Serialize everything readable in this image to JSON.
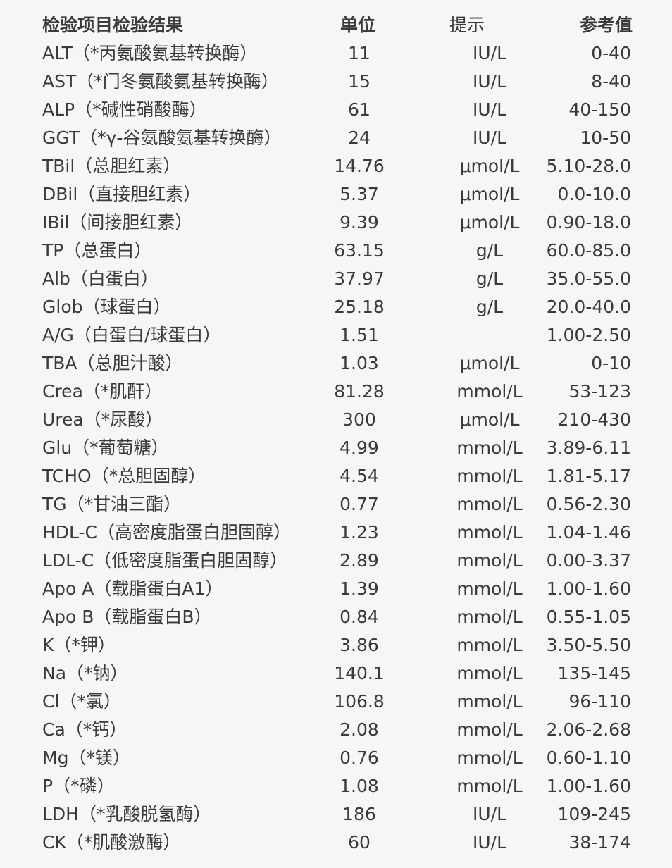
{
  "header": {
    "item_result": "检验项目检验结果",
    "unit": "单位",
    "hint": "提示",
    "reference": "参考值"
  },
  "rows": [
    {
      "name": "ALT（*丙氨酸氨基转换酶）",
      "value": "11",
      "unit": "IU/L",
      "reference": "0-40"
    },
    {
      "name": "AST（*门冬氨酸氨基转换酶）",
      "value": "15",
      "unit": "IU/L",
      "reference": "8-40"
    },
    {
      "name": "ALP（*碱性硝酸酶）",
      "value": "61",
      "unit": "IU/L",
      "reference": "40-150"
    },
    {
      "name": "GGT（*γ-谷氨酸氨基转换酶）",
      "value": "24",
      "unit": "IU/L",
      "reference": "10-50"
    },
    {
      "name": "TBil（总胆红素）",
      "value": "14.76",
      "unit": "μmol/L",
      "reference": "5.10-28.0"
    },
    {
      "name": "DBil（直接胆红素）",
      "value": "5.37",
      "unit": "μmol/L",
      "reference": "0.0-10.0"
    },
    {
      "name": "IBil（间接胆红素）",
      "value": "9.39",
      "unit": "μmol/L",
      "reference": "0.90-18.0"
    },
    {
      "name": "TP（总蛋白）",
      "value": "63.15",
      "unit": "g/L",
      "reference": "60.0-85.0"
    },
    {
      "name": "Alb（白蛋白）",
      "value": "37.97",
      "unit": "g/L",
      "reference": "35.0-55.0"
    },
    {
      "name": "Glob（球蛋白）",
      "value": "25.18",
      "unit": "g/L",
      "reference": "20.0-40.0"
    },
    {
      "name": "A/G（白蛋白/球蛋白）",
      "value": "1.51",
      "unit": "",
      "reference": "1.00-2.50"
    },
    {
      "name": "TBA（总胆汁酸）",
      "value": "1.03",
      "unit": "μmol/L",
      "reference": "0-10"
    },
    {
      "name": "Crea（*肌酐）",
      "value": "81.28",
      "unit": "mmol/L",
      "reference": "53-123"
    },
    {
      "name": "Urea（*尿酸）",
      "value": "300",
      "unit": "μmol/L",
      "reference": "210-430"
    },
    {
      "name": "Glu（*葡萄糖）",
      "value": "4.99",
      "unit": "mmol/L",
      "reference": "3.89-6.11"
    },
    {
      "name": "TCHO（*总胆固醇）",
      "value": "4.54",
      "unit": "mmol/L",
      "reference": "1.81-5.17"
    },
    {
      "name": "TG（*甘油三酯）",
      "value": "0.77",
      "unit": "mmol/L",
      "reference": "0.56-2.30"
    },
    {
      "name": "HDL-C（高密度脂蛋白胆固醇）",
      "value": "1.23",
      "unit": "mmol/L",
      "reference": "1.04-1.46"
    },
    {
      "name": "LDL-C（低密度脂蛋白胆固醇）",
      "value": "2.89",
      "unit": "mmol/L",
      "reference": "0.00-3.37"
    },
    {
      "name": "Apo A（载脂蛋白A1）",
      "value": "1.39",
      "unit": "mmol/L",
      "reference": "1.00-1.60"
    },
    {
      "name": "Apo B（载脂蛋白B）",
      "value": "0.84",
      "unit": "mmol/L",
      "reference": "0.55-1.05"
    },
    {
      "name": "K（*钾）",
      "value": "3.86",
      "unit": "mmol/L",
      "reference": "3.50-5.50"
    },
    {
      "name": "Na（*钠）",
      "value": "140.1",
      "unit": "mmol/L",
      "reference": "135-145"
    },
    {
      "name": "Cl（*氯）",
      "value": "106.8",
      "unit": "mmol/L",
      "reference": "96-110"
    },
    {
      "name": "Ca（*钙）",
      "value": "2.08",
      "unit": "mmol/L",
      "reference": "2.06-2.68"
    },
    {
      "name": "Mg（*镁）",
      "value": "0.76",
      "unit": "mmol/L",
      "reference": "0.60-1.10"
    },
    {
      "name": "P（*磷）",
      "value": "1.08",
      "unit": "mmol/L",
      "reference": "1.00-1.60"
    },
    {
      "name": "LDH（*乳酸脱氢酶）",
      "value": "186",
      "unit": "IU/L",
      "reference": "109-245"
    },
    {
      "name": "CK（*肌酸激酶）",
      "value": "60",
      "unit": "IU/L",
      "reference": "38-174"
    }
  ]
}
